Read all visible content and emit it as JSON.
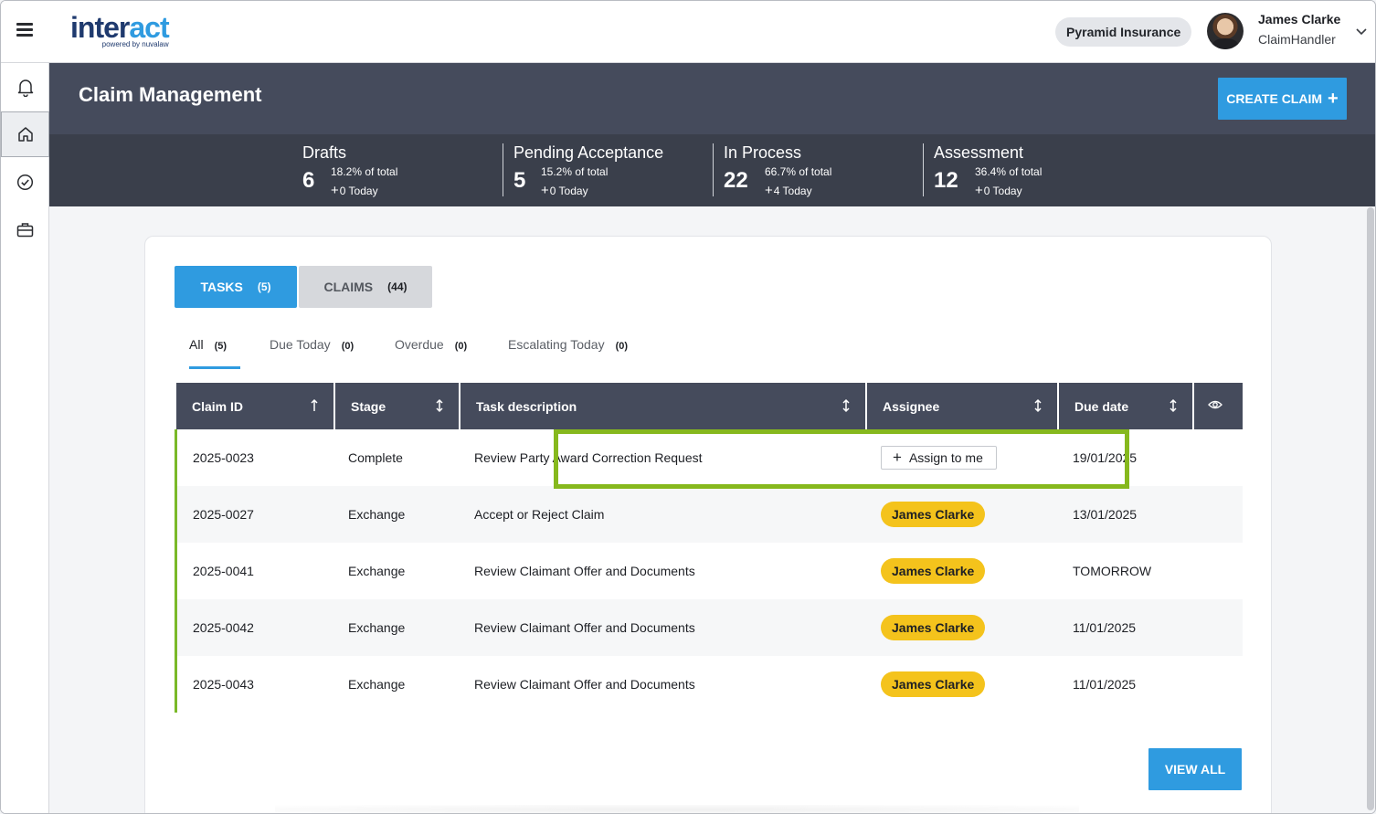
{
  "app": {
    "logo_main": "inter",
    "logo_accent": "act",
    "logo_sub": "powered by nuvalaw"
  },
  "topbar": {
    "company": "Pyramid Insurance",
    "user_name": "James Clarke",
    "user_role": "ClaimHandler"
  },
  "nav_icons": [
    "bell-icon",
    "home-icon",
    "check-circle-icon",
    "briefcase-icon"
  ],
  "header": {
    "title": "Claim Management",
    "create_label": "CREATE CLAIM",
    "create_icon": "+"
  },
  "stats": [
    {
      "label": "Drafts",
      "count": "6",
      "pct": "18.2% of total",
      "today": "0 Today",
      "today_sign": "+"
    },
    {
      "label": "Pending Acceptance",
      "count": "5",
      "pct": "15.2% of total",
      "today": "0 Today",
      "today_sign": "+"
    },
    {
      "label": "In Process",
      "count": "22",
      "pct": "66.7% of total",
      "today": "4 Today",
      "today_sign": "+"
    },
    {
      "label": "Assessment",
      "count": "12",
      "pct": "36.4% of total",
      "today": "0 Today",
      "today_sign": "+"
    }
  ],
  "tabs": [
    {
      "label": "TASKS",
      "count": "(5)",
      "active": true
    },
    {
      "label": "CLAIMS",
      "count": "(44)",
      "active": false
    }
  ],
  "filters": [
    {
      "label": "All",
      "count": "(5)",
      "active": true
    },
    {
      "label": "Due Today",
      "count": "(0)",
      "active": false
    },
    {
      "label": "Overdue",
      "count": "(0)",
      "active": false
    },
    {
      "label": "Escalating Today",
      "count": "(0)",
      "active": false
    }
  ],
  "table": {
    "columns": [
      "Claim ID",
      "Stage",
      "Task description",
      "Assignee",
      "Due date"
    ],
    "assign_label": "Assign to me",
    "rows": [
      {
        "claim_id": "2025-0023",
        "stage": "Complete",
        "task": "Review Party Award Correction Request",
        "assignee": "",
        "due": "19/01/2025"
      },
      {
        "claim_id": "2025-0027",
        "stage": "Exchange",
        "task": "Accept or Reject Claim",
        "assignee": "James Clarke",
        "due": "13/01/2025"
      },
      {
        "claim_id": "2025-0041",
        "stage": "Exchange",
        "task": "Review Claimant Offer and Documents",
        "assignee": "James Clarke",
        "due": "TOMORROW"
      },
      {
        "claim_id": "2025-0042",
        "stage": "Exchange",
        "task": "Review Claimant Offer and Documents",
        "assignee": "James Clarke",
        "due": "11/01/2025"
      },
      {
        "claim_id": "2025-0043",
        "stage": "Exchange",
        "task": "Review Claimant Offer and Documents",
        "assignee": "James Clarke",
        "due": "11/01/2025"
      }
    ]
  },
  "view_all_label": "VIEW ALL",
  "colors": {
    "accent": "#2f9be0",
    "header_bg": "#454b5c",
    "stats_bg": "#3a3f4b",
    "assignee_badge": "#f4c31c",
    "row_marker": "#7ab928",
    "highlight": "#86b81d"
  }
}
